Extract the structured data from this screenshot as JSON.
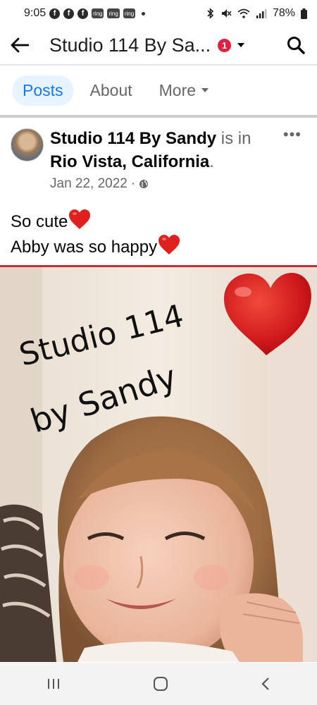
{
  "status_bar": {
    "time": "9:05",
    "ring_labels": [
      "ring",
      "ring",
      "ring"
    ],
    "battery": "78%"
  },
  "header": {
    "title": "Studio 114 By Sa...",
    "notification_count": "1"
  },
  "tabs": [
    {
      "label": "Posts",
      "active": true
    },
    {
      "label": "About",
      "active": false
    },
    {
      "label": "More",
      "active": false
    }
  ],
  "post": {
    "author": "Studio 114 By Sandy",
    "connector": "is in",
    "location": "Rio Vista, California",
    "date": "Jan 22, 2022",
    "text_line1": "So cute",
    "text_line2": "Abby was so happy",
    "image_text_line1": "Studio 114",
    "image_text_line2": "by Sandy"
  },
  "colors": {
    "accent": "#1877f2",
    "badge": "#e41e3f",
    "heart": "#e0201f"
  }
}
